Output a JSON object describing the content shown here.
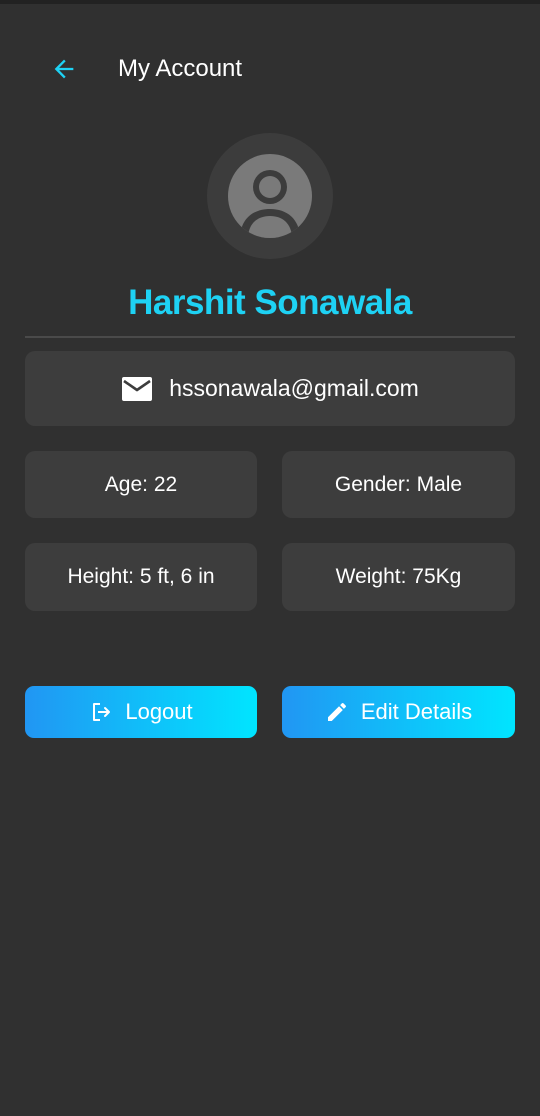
{
  "header": {
    "title": "My Account",
    "back_icon": "arrow-left-icon"
  },
  "profile": {
    "avatar_icon": "account-circle-icon",
    "name": "Harshit Sonawala"
  },
  "details": {
    "email": "hssonawala@gmail.com",
    "email_icon": "mail-icon",
    "age": "Age: 22",
    "gender": "Gender: Male",
    "height": "Height: 5 ft, 6 in",
    "weight": "Weight: 75Kg"
  },
  "actions": {
    "logout_label": "Logout",
    "logout_icon": "logout-icon",
    "edit_label": "Edit Details",
    "edit_icon": "pencil-icon"
  },
  "colors": {
    "background": "#303030",
    "card": "#3d3d3d",
    "accent": "#1ed2f4",
    "gradient_start": "#2196f3",
    "gradient_end": "#00e5ff"
  }
}
